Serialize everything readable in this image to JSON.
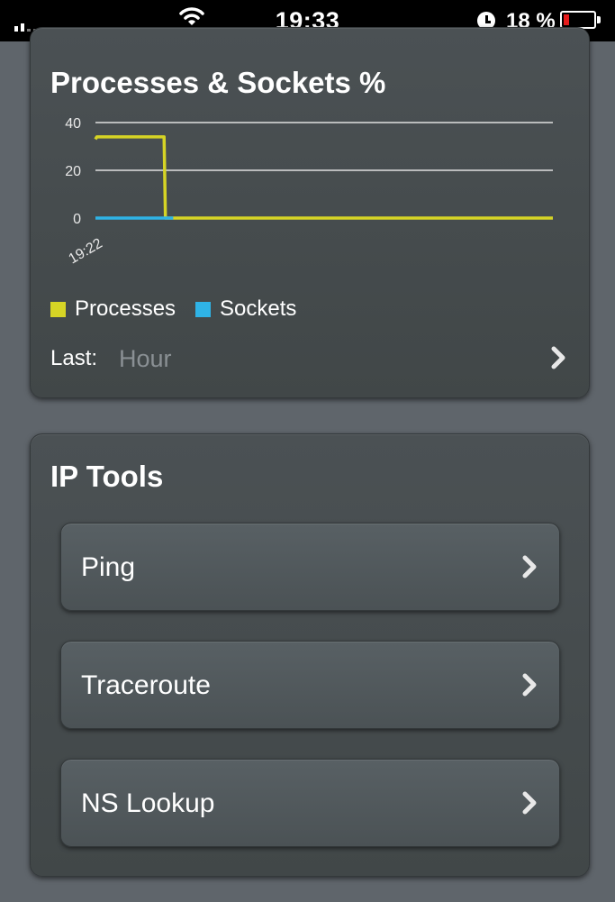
{
  "status_bar": {
    "time": "19:33",
    "battery_percent": "18 %",
    "battery_level": 0.18,
    "signal_bars": 2
  },
  "processes_panel": {
    "title": "Processes & Sockets %",
    "last_label": "Last:",
    "last_value": "Hour"
  },
  "chart_data": {
    "type": "line",
    "title": "Processes & Sockets %",
    "x_tick_labels": [
      "19:22"
    ],
    "y_ticks": [
      0,
      20,
      40
    ],
    "ylim": [
      0,
      40
    ],
    "grid": true,
    "legend_placement": "bottom-left",
    "series": [
      {
        "name": "Processes",
        "color": "#d6d425",
        "x": [
          0,
          0.3,
          1.5,
          15,
          15.3,
          17,
          100
        ],
        "values": [
          33,
          34,
          34,
          34,
          0,
          0,
          0
        ]
      },
      {
        "name": "Sockets",
        "color": "#2fb3e6",
        "x": [
          0,
          17
        ],
        "values": [
          0,
          0
        ]
      }
    ],
    "x_range": [
      0,
      100
    ]
  },
  "ip_tools": {
    "title": "IP Tools",
    "buttons": [
      {
        "label": "Ping"
      },
      {
        "label": "Traceroute"
      },
      {
        "label": "NS Lookup"
      }
    ]
  },
  "icons": {
    "chevron": "chevron-right-icon",
    "wifi": "wifi-icon",
    "alarm": "alarm-clock-icon",
    "battery": "battery-icon",
    "signal": "signal-strength-icon"
  }
}
